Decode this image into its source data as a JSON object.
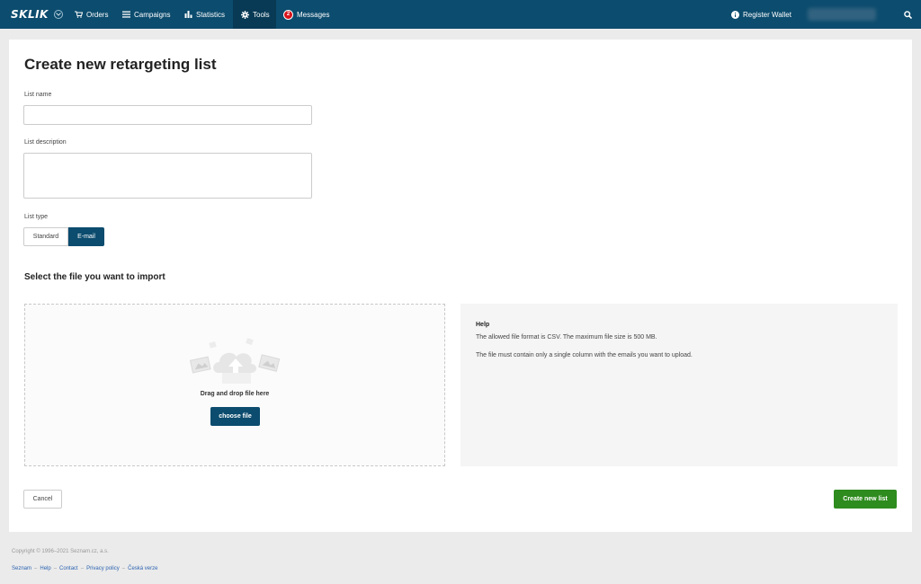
{
  "nav": {
    "logo": "SKLIK",
    "items": [
      {
        "label": "Orders",
        "icon": "cart-icon"
      },
      {
        "label": "Campaigns",
        "icon": "list-icon"
      },
      {
        "label": "Statistics",
        "icon": "bar-chart-icon"
      },
      {
        "label": "Tools",
        "icon": "gear-icon"
      },
      {
        "label": "Messages",
        "icon": "messages-badge-icon",
        "badge": "2"
      }
    ],
    "register_wallet": "Register Wallet",
    "colors": {
      "bar": "#0c4c6e",
      "active": "#083a55",
      "badge": "#d7131b"
    }
  },
  "page": {
    "title": "Create new retargeting list"
  },
  "form": {
    "list_name_label": "List name",
    "list_name_value": "",
    "list_description_label": "List description",
    "list_description_value": "",
    "list_type_label": "List type",
    "list_type_options": [
      "Standard",
      "E-mail"
    ],
    "list_type_selected": "E-mail"
  },
  "import": {
    "section_title": "Select the file you want to import",
    "drop_text": "Drag and drop file here",
    "choose_button": "choose file"
  },
  "help": {
    "title": "Help",
    "lines": [
      "The allowed file format is CSV. The maximum file size is 500 MB.",
      "The file must contain only a single column with the emails you want to upload."
    ]
  },
  "actions": {
    "cancel": "Cancel",
    "create": "Create new list",
    "create_color": "#2e8b1e"
  },
  "footer": {
    "copyright": "Copyright © 1996–2021 Seznam.cz, a.s.",
    "links": [
      "Seznam",
      "Help",
      "Contact",
      "Privacy policy",
      "Česká verze"
    ],
    "separator": "–"
  }
}
